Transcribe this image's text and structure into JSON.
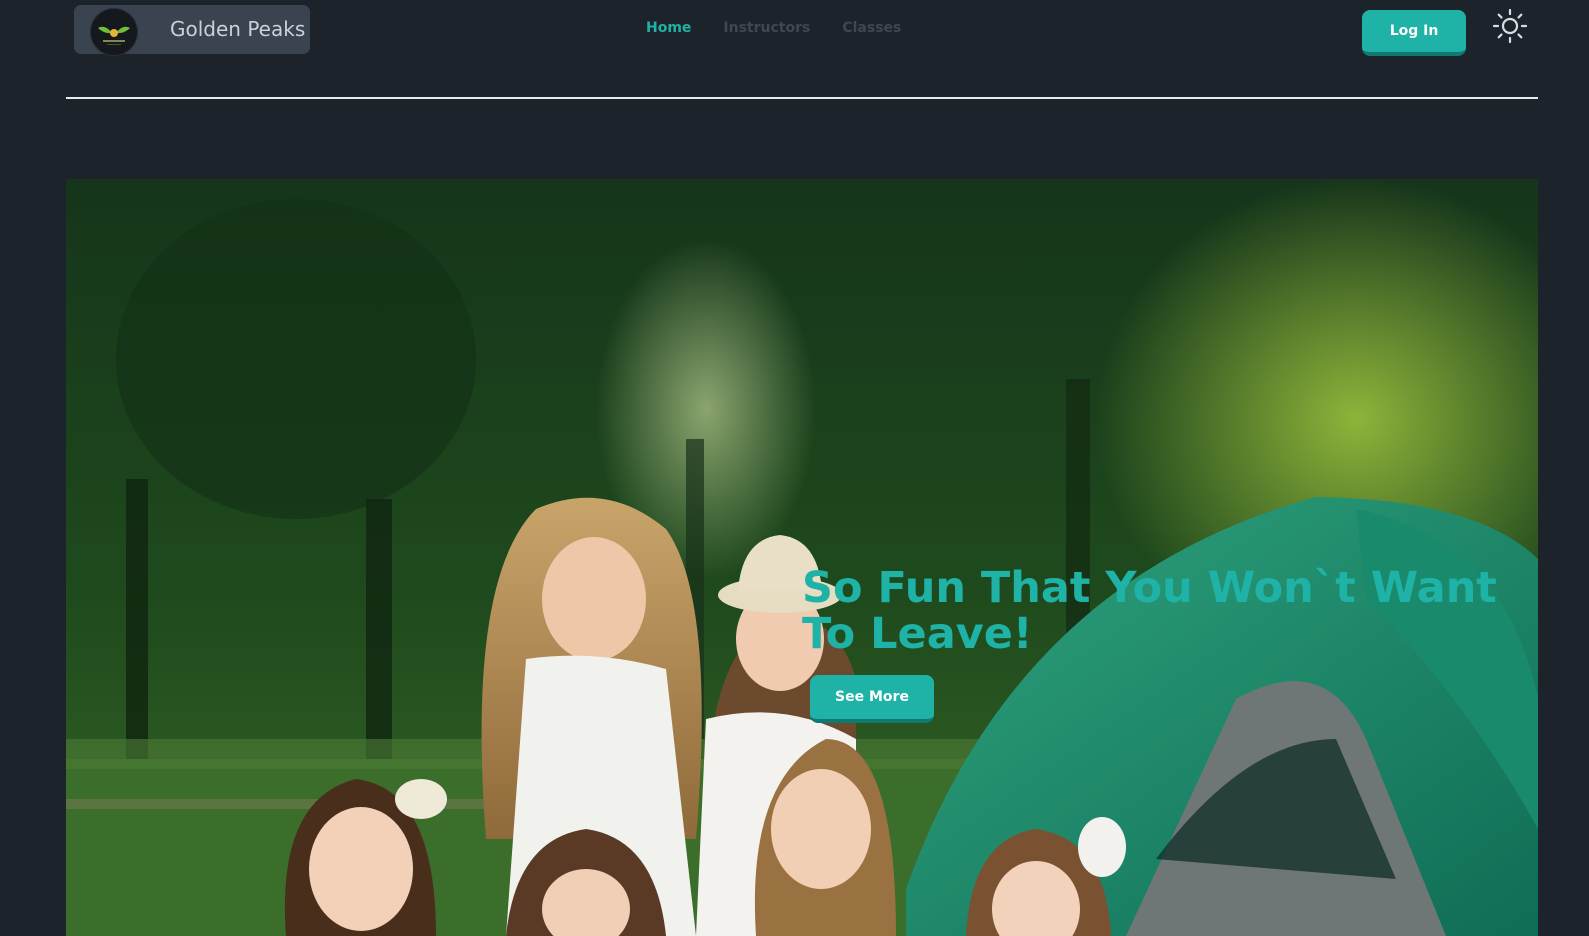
{
  "brand": {
    "name": "Golden Peaks",
    "logo_icon": "winged-crest-logo",
    "logo_text": "Golden Peaks"
  },
  "nav": {
    "links": [
      {
        "label": "Home",
        "active": true
      },
      {
        "label": "Instructors",
        "active": false
      },
      {
        "label": "Classes",
        "active": false
      }
    ]
  },
  "header": {
    "login_label": "Log In",
    "theme_toggle_icon": "sun-icon"
  },
  "hero": {
    "title": "So Fun That You Won`t Want To Leave!",
    "button_label": "See More",
    "image": "children-camping-in-forest-photo"
  },
  "colors": {
    "background": "#1d232a",
    "accent": "#1fb2a6",
    "brand_bg": "#3a4350",
    "nav_inactive": "#3e4754"
  }
}
